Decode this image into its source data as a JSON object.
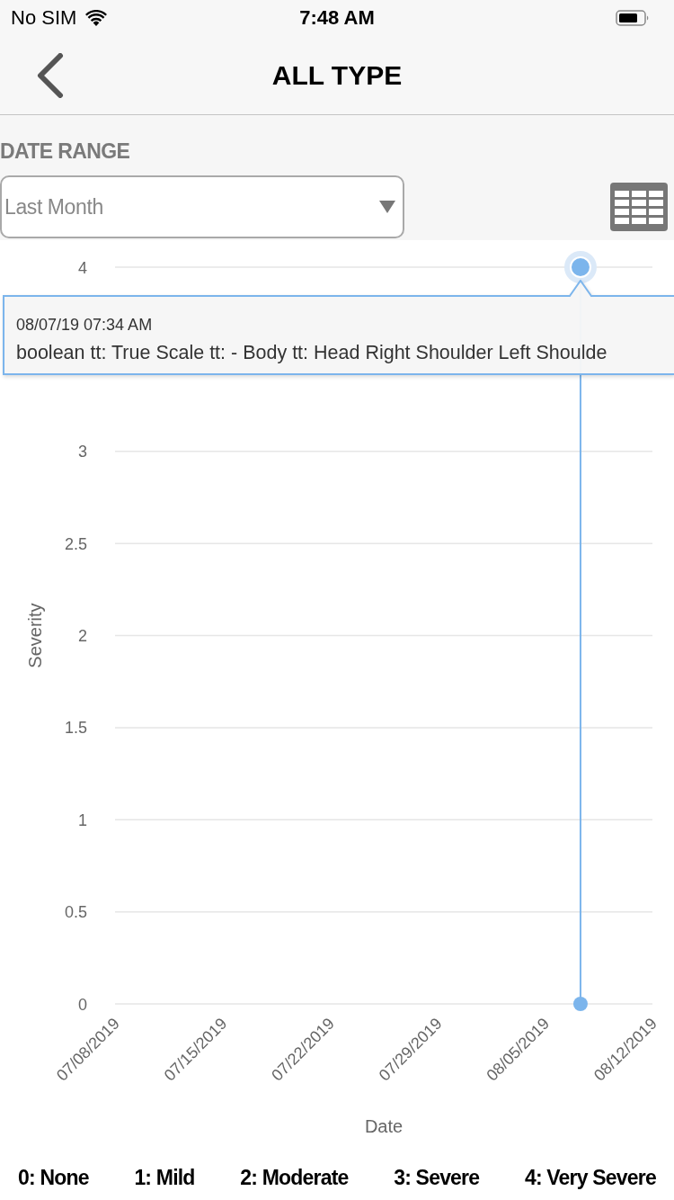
{
  "status_bar": {
    "carrier": "No SIM",
    "time": "7:48 AM"
  },
  "nav_bar": {
    "title": "ALL TYPE"
  },
  "filters": {
    "date_range_label": "DATE RANGE",
    "date_range": {
      "value": "Last Month"
    }
  },
  "chart": {
    "chart_data": {
      "type": "line",
      "xlabel": "Date",
      "ylabel": "Severity",
      "grid": true,
      "x": [
        "2019-08-07T07:34",
        "2019-08-07T07:34"
      ],
      "series": [
        {
          "color": "#7cb5ec",
          "marker": true,
          "values": [
            4,
            0
          ]
        }
      ],
      "xlim": [
        "2019-07-08",
        "2019-08-12"
      ],
      "ylim": [
        0,
        4
      ],
      "xticks": [
        {
          "value": "2019-07-08",
          "label": "07/08/2019"
        },
        {
          "value": "2019-07-15",
          "label": "07/15/2019"
        },
        {
          "value": "2019-07-22",
          "label": "07/22/2019"
        },
        {
          "value": "2019-07-29",
          "label": "07/29/2019"
        },
        {
          "value": "2019-08-05",
          "label": "08/05/2019"
        },
        {
          "value": "2019-08-12",
          "label": "08/12/2019"
        }
      ],
      "yticks": [
        0,
        0.5,
        1,
        1.5,
        2,
        2.5,
        3,
        4
      ]
    },
    "tooltip": {
      "time": "08/07/19 07:34 AM",
      "text": "boolean tt: True Scale tt: - Body tt: Head Right Shoulder Left Shoulde"
    }
  },
  "severity_key": [
    "0: None",
    "1: Mild",
    "2: Moderate",
    "3: Severe",
    "4: Very Severe"
  ]
}
